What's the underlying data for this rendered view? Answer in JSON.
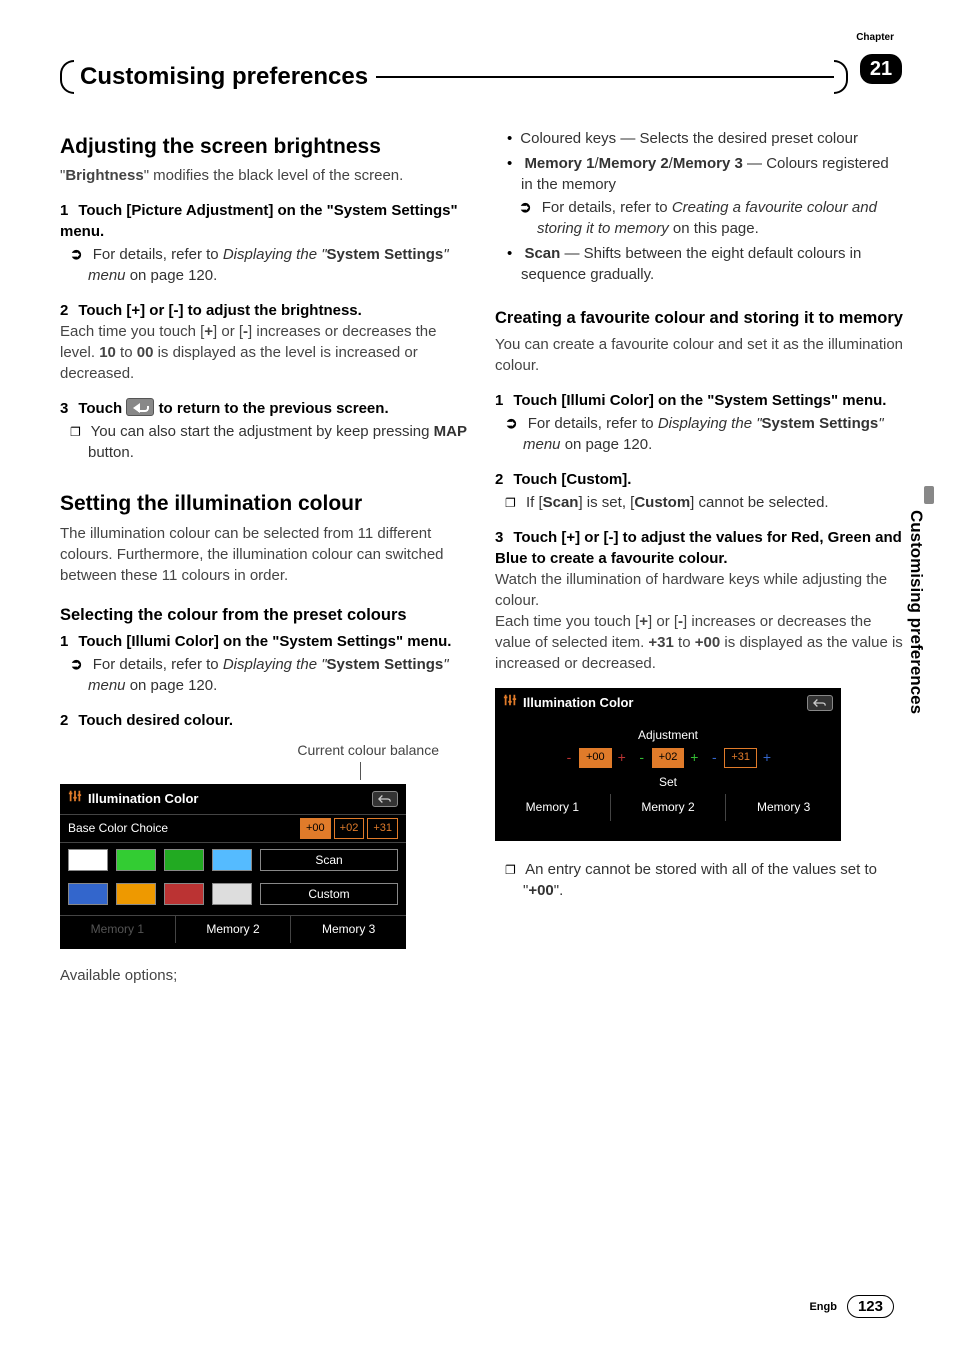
{
  "chapter": {
    "label": "Chapter",
    "number": "21"
  },
  "page_title": "Customising preferences",
  "side_tab": "Customising preferences",
  "footer": {
    "lang": "Engb",
    "page": "123"
  },
  "left": {
    "h_brightness": "Adjusting the screen brightness",
    "brightness_intro_a": "\"",
    "brightness_intro_b": "Brightness",
    "brightness_intro_c": "\" modifies the black level of the screen.",
    "s1": {
      "num": "1",
      "txt": "Touch [Picture Adjustment] on the \"System Settings\" menu."
    },
    "s1_ref_a": "For details, refer to ",
    "s1_ref_b": "Displaying the \"",
    "s1_ref_c": "System Settings",
    "s1_ref_d": "\" menu",
    "s1_ref_e": " on page 120.",
    "s2": {
      "num": "2",
      "txt": "Touch [+] or [-] to adjust the brightness."
    },
    "s2_body_a": "Each time you touch [",
    "s2_body_b": "+",
    "s2_body_c": "] or [",
    "s2_body_d": "-",
    "s2_body_e": "] increases or decreases the level. ",
    "s2_body_f": "10",
    "s2_body_g": " to ",
    "s2_body_h": "00",
    "s2_body_i": " is displayed as the level is increased or decreased.",
    "s3a": {
      "num": "3",
      "txt_a": "Touch ",
      "txt_b": " to return to the previous screen."
    },
    "s3_note_a": "You can also start the adjustment by keep pressing ",
    "s3_note_b": "MAP",
    "s3_note_c": " button.",
    "h_illum": "Setting the illumination colour",
    "illum_intro": "The illumination colour can be selected from 11 different colours. Furthermore, the illumination colour can switched between these 11 colours in order.",
    "h_select": "Selecting the colour from the preset colours",
    "sel_s1": {
      "num": "1",
      "txt": "Touch [Illumi Color] on the \"System Settings\" menu."
    },
    "sel_s1_ref_a": "For details, refer to ",
    "sel_s1_ref_b": "Displaying the \"",
    "sel_s1_ref_c": "System Settings",
    "sel_s1_ref_d": "\" menu",
    "sel_s1_ref_e": " on page 120.",
    "sel_s2": {
      "num": "2",
      "txt": "Touch desired colour."
    },
    "caption": "Current colour balance",
    "ss1": {
      "title": "Illumination Color",
      "base": "Base Color Choice",
      "vals": [
        "+00",
        "+02",
        "+31"
      ],
      "row1": [
        "#fff",
        "#3c3",
        "#2a2",
        "#5bf"
      ],
      "row1_btn": "Scan",
      "row2": [
        "#36c",
        "#e90",
        "#b33",
        "#ddd"
      ],
      "row2_btn": "Custom",
      "mem": [
        "Memory 1",
        "Memory 2",
        "Memory 3"
      ]
    },
    "avail": "Available options;"
  },
  "right": {
    "b1_a": "Coloured keys — Selects the desired preset colour",
    "b2_a": "Memory 1",
    "b2_b": "/",
    "b2_c": "Memory 2",
    "b2_d": "/",
    "b2_e": "Memory 3",
    "b2_f": " — Colours registered in the memory",
    "b2_ref_a": "For details, refer to ",
    "b2_ref_b": "Creating a favourite colour and storing it to memory",
    "b2_ref_c": " on this page.",
    "b3_a": "Scan",
    "b3_b": " — Shifts between the eight default colours in sequence gradually.",
    "h_create": "Creating a favourite colour and storing it to memory",
    "create_intro": "You can create a favourite colour and set it as the illumination colour.",
    "c_s1": {
      "num": "1",
      "txt": "Touch [Illumi Color] on the \"System Settings\" menu."
    },
    "c_s1_ref_a": "For details, refer to ",
    "c_s1_ref_b": "Displaying the \"",
    "c_s1_ref_c": "System Settings",
    "c_s1_ref_d": "\" menu",
    "c_s1_ref_e": " on page 120.",
    "c_s2": {
      "num": "2",
      "txt": "Touch [Custom]."
    },
    "c_s2_note_a": "If [",
    "c_s2_note_b": "Scan",
    "c_s2_note_c": "] is set, [",
    "c_s2_note_d": "Custom",
    "c_s2_note_e": "] cannot be selected.",
    "c_s3": {
      "num": "3",
      "txt": "Touch [+] or [-] to adjust the values for Red, Green and Blue to create a favourite colour."
    },
    "c_s3_body1": "Watch the illumination of hardware keys while adjusting the colour.",
    "c_s3_body2_a": "Each time you touch [",
    "c_s3_body2_b": "+",
    "c_s3_body2_c": "] or [",
    "c_s3_body2_d": "-",
    "c_s3_body2_e": "] increases or decreases the value of selected item. ",
    "c_s3_body2_f": "+31",
    "c_s3_body2_g": " to ",
    "c_s3_body2_h": "+00",
    "c_s3_body2_i": " is displayed as the value is increased or decreased.",
    "ss2": {
      "title": "Illumination Color",
      "adj": "Adjustment",
      "vals": [
        "+00",
        "+02",
        "+31"
      ],
      "set": "Set",
      "mem": [
        "Memory 1",
        "Memory 2",
        "Memory 3"
      ]
    },
    "c_note_a": "An entry cannot be stored with all of the values set to \"",
    "c_note_b": "+00",
    "c_note_c": "\"."
  }
}
